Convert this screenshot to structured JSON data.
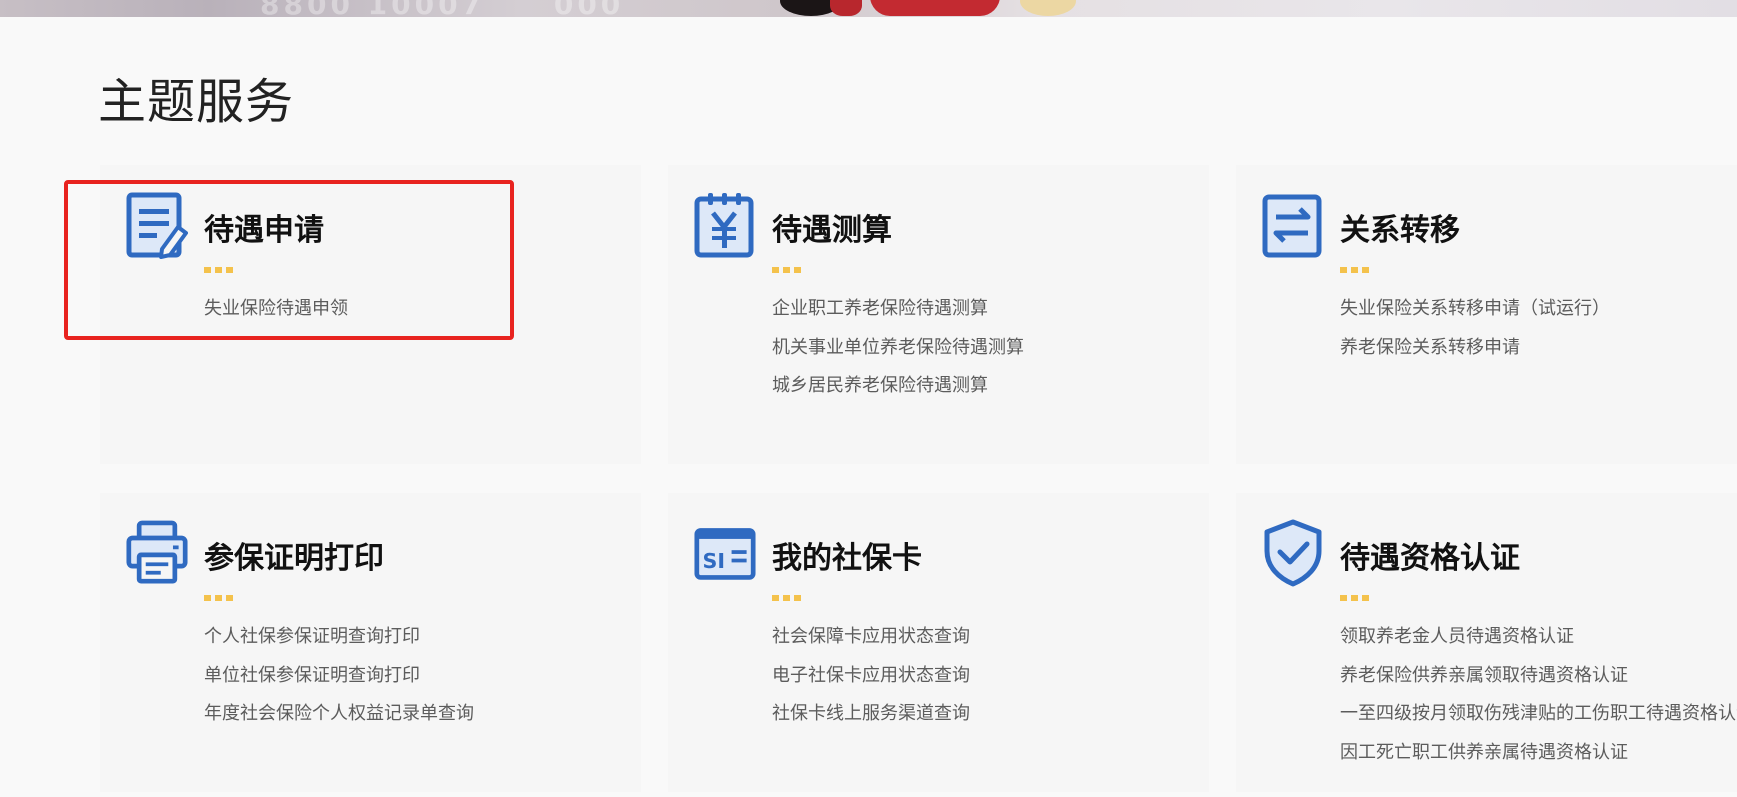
{
  "section": {
    "title": "主题服务"
  },
  "colors": {
    "icon_blue": "#2f6ac1",
    "dot_yellow": "#f4c24c",
    "highlight_red": "#e8231f"
  },
  "cards": [
    {
      "title": "待遇申请",
      "icon": "document-edit-icon",
      "links": [
        "失业保险待遇申领"
      ]
    },
    {
      "title": "待遇测算",
      "icon": "calendar-yuan-icon",
      "links": [
        "企业职工养老保险待遇测算",
        "机关事业单位养老保险待遇测算",
        "城乡居民养老保险待遇测算"
      ]
    },
    {
      "title": "关系转移",
      "icon": "transfer-arrows-icon",
      "links": [
        "失业保险关系转移申请（试运行）",
        "养老保险关系转移申请"
      ]
    },
    {
      "title": "参保证明打印",
      "icon": "printer-icon",
      "links": [
        "个人社保参保证明查询打印",
        "单位社保参保证明查询打印",
        "年度社会保险个人权益记录单查询"
      ]
    },
    {
      "title": "我的社保卡",
      "icon": "si-card-icon",
      "links": [
        "社会保障卡应用状态查询",
        "电子社保卡应用状态查询",
        "社保卡线上服务渠道查询"
      ]
    },
    {
      "title": "待遇资格认证",
      "icon": "shield-check-icon",
      "links": [
        "领取养老金人员待遇资格认证",
        "养老保险供养亲属领取待遇资格认证",
        "一至四级按月领取伤残津贴的工伤职工待遇资格认证",
        "因工死亡职工供养亲属待遇资格认证"
      ]
    }
  ]
}
